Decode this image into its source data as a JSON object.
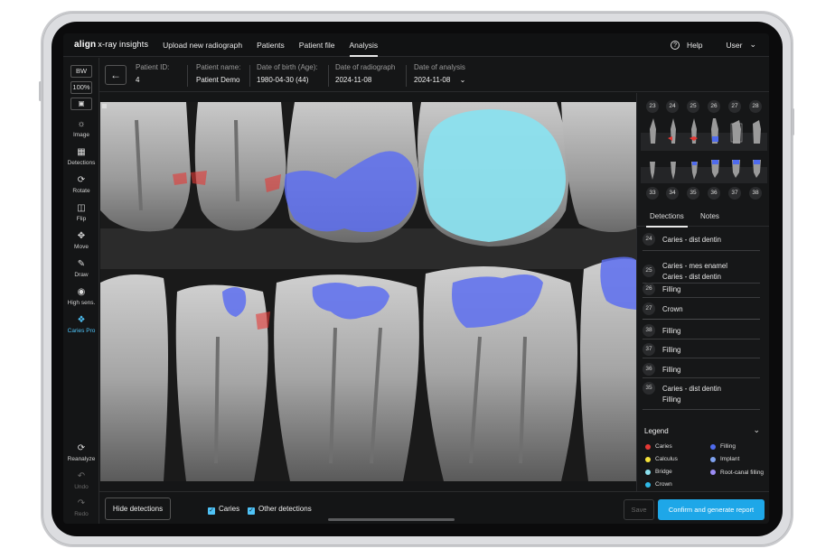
{
  "topnav": {
    "logo_brand": "align",
    "logo_product": "x-ray insights",
    "links": [
      "Upload new radiograph",
      "Patients",
      "Patient file",
      "Analysis"
    ],
    "help": "Help",
    "user": "User"
  },
  "patient": {
    "back_icon": "arrow-left-icon",
    "id_label": "Patient ID:",
    "id_value": "4",
    "name_label": "Patient name:",
    "name_value": "Patient Demo",
    "dob_label": "Date of birth (Age):",
    "dob_value": "1980-04-30 (44)",
    "radiograph_label": "Date of radiograph",
    "radiograph_value": "2024-11-08",
    "analysis_label": "Date of analysis",
    "analysis_value": "2024-11-08"
  },
  "tools": {
    "bw": "BW",
    "zoom": "100%",
    "items": [
      {
        "label": "Image",
        "icon": "sun-icon"
      },
      {
        "label": "Detections",
        "icon": "grid-icon"
      },
      {
        "label": "Rotate",
        "icon": "rotate-icon"
      },
      {
        "label": "Flip",
        "icon": "flip-icon"
      },
      {
        "label": "Move",
        "icon": "move-icon"
      },
      {
        "label": "Draw",
        "icon": "pen-icon"
      },
      {
        "label": "High sens.",
        "icon": "eye-icon"
      },
      {
        "label": "Caries Pro",
        "icon": "tooth-icon"
      }
    ],
    "reanalyze": "Reanalyze",
    "undo": "Undo",
    "redo": "Redo"
  },
  "teeth": {
    "upper": [
      "23",
      "24",
      "25",
      "26",
      "27",
      "28"
    ],
    "lower": [
      "33",
      "34",
      "35",
      "36",
      "37",
      "38"
    ]
  },
  "panel": {
    "tab_detections": "Detections",
    "tab_notes": "Notes",
    "detections": [
      {
        "num": "24",
        "lines": [
          "Caries - dist dentin"
        ]
      },
      {
        "num": "25",
        "lines": [
          "Caries - mes enamel",
          "Caries - dist dentin"
        ]
      },
      {
        "num": "26",
        "lines": [
          "Filling"
        ]
      },
      {
        "num": "27",
        "lines": [
          "Crown"
        ]
      },
      {
        "num": "38",
        "lines": [
          "Filling"
        ]
      },
      {
        "num": "37",
        "lines": [
          "Filling"
        ]
      },
      {
        "num": "36",
        "lines": [
          "Filling"
        ]
      },
      {
        "num": "35",
        "lines": [
          "Caries - dist dentin",
          "Filling"
        ]
      }
    ],
    "legend_title": "Legend",
    "legend": [
      {
        "label": "Caries",
        "color": "#e53935"
      },
      {
        "label": "Filling",
        "color": "#4f6bed"
      },
      {
        "label": "Calculus",
        "color": "#f4e23a"
      },
      {
        "label": "Implant",
        "color": "#7fa2f0"
      },
      {
        "label": "Bridge",
        "color": "#8be0ee"
      },
      {
        "label": "Root-canal filling",
        "color": "#9b8cf5"
      },
      {
        "label": "Crown",
        "color": "#2fb8e6"
      }
    ]
  },
  "bottom": {
    "hide": "Hide detections",
    "caries": "Caries",
    "other": "Other detections",
    "save": "Save",
    "confirm": "Confirm and generate report"
  },
  "colors": {
    "accent": "#1ea7e8",
    "filling": "#4f6bed",
    "crown": "#8be0ee",
    "caries": "#e53935"
  }
}
